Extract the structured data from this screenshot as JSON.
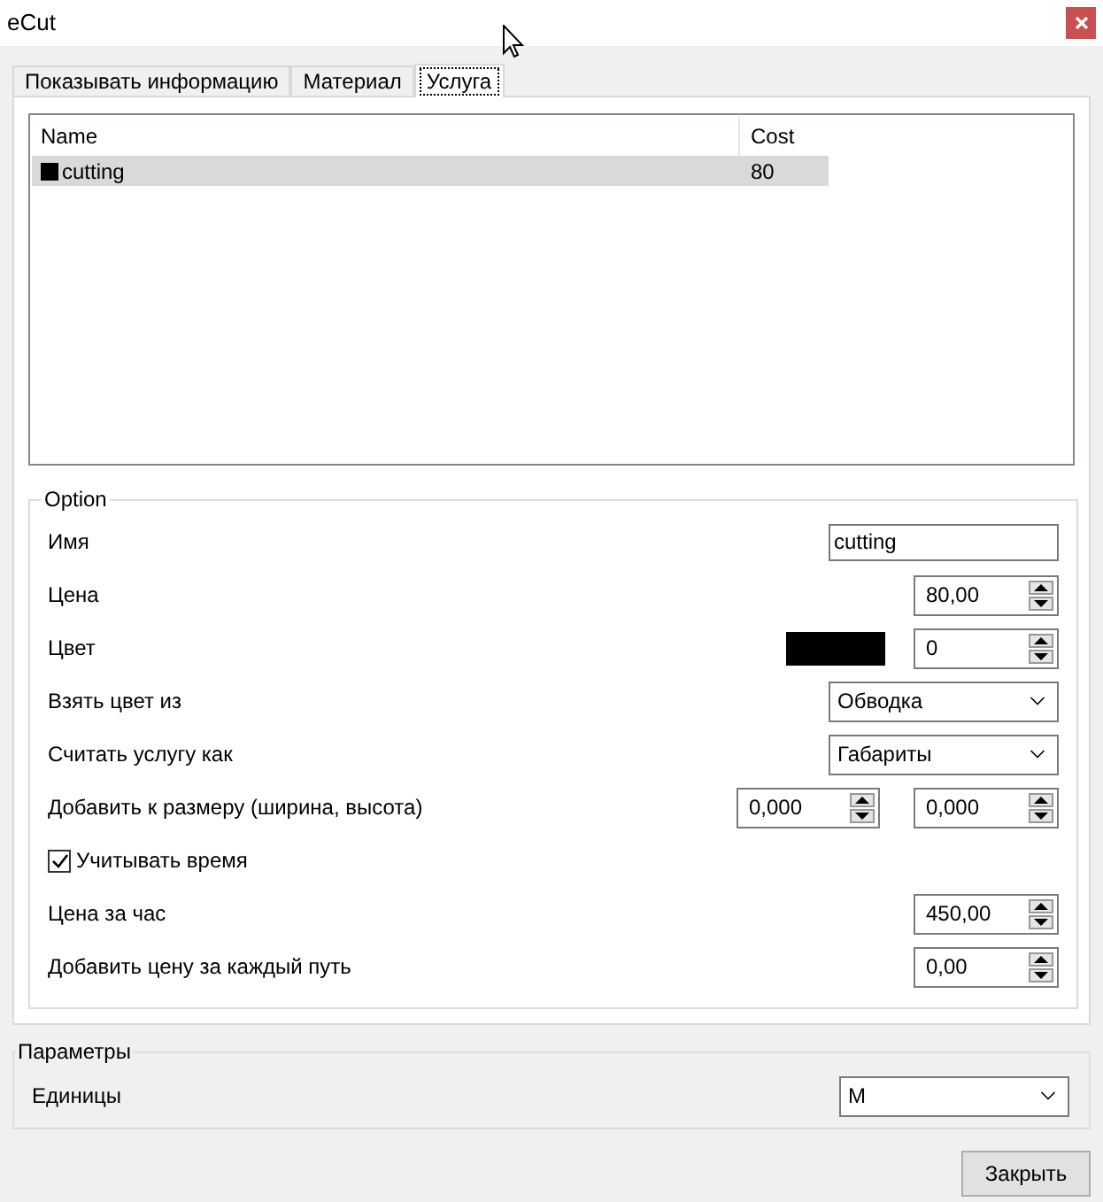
{
  "window": {
    "title": "eCut"
  },
  "tabs": [
    {
      "label": "Показывать информацию",
      "selected": false
    },
    {
      "label": "Материал",
      "selected": false
    },
    {
      "label": "Услуга",
      "selected": true
    }
  ],
  "service_list": {
    "columns": [
      "Name",
      "Cost"
    ],
    "rows": [
      {
        "name": "cutting",
        "cost": "80",
        "color": "#000000",
        "selected": true
      }
    ]
  },
  "option": {
    "title": "Option",
    "rows": [
      {
        "kind": "text",
        "label": "Имя",
        "value": "cutting"
      },
      {
        "kind": "spin",
        "label": "Цена",
        "value": "80,00"
      },
      {
        "kind": "color",
        "label": "Цвет",
        "color": "#000000",
        "value": "0"
      },
      {
        "kind": "combo",
        "label": "Взять цвет из",
        "value": "Обводка"
      },
      {
        "kind": "combo",
        "label": "Считать услугу как",
        "value": "Габариты"
      },
      {
        "kind": "spin2",
        "label": "Добавить к размеру (ширина, высота)",
        "values": [
          "0,000",
          "0,000"
        ]
      },
      {
        "kind": "checkbox",
        "label": "Учитывать время",
        "checked": true
      },
      {
        "kind": "spin",
        "label": "Цена за час",
        "value": "450,00"
      },
      {
        "kind": "spin",
        "label": "Добавить цену за каждый путь",
        "value": "0,00"
      }
    ]
  },
  "parameters": {
    "title": "Параметры",
    "units": {
      "label": "Единицы",
      "value": "М"
    }
  },
  "buttons": [
    {
      "label": "Закрыть"
    }
  ]
}
